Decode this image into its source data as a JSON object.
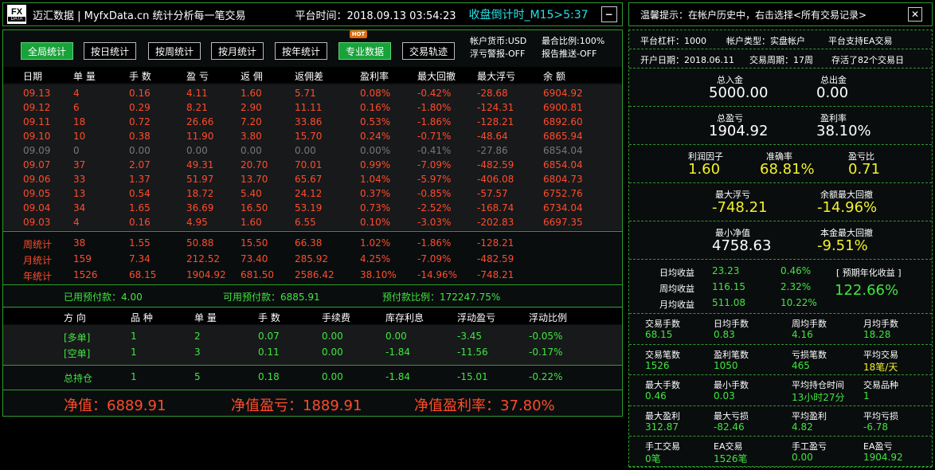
{
  "header": {
    "logo_top": "FX",
    "logo_bottom": "DATA",
    "brand": "迈汇数据 | MyfxData.cn  统计分析每一笔交易",
    "platform_time": "平台时间：2018.09.13 03:54:23",
    "countdown": "收盘倒计时_M15>5:37",
    "minimize": "−"
  },
  "tabs": [
    {
      "label": "全局统计",
      "active": true
    },
    {
      "label": "按日统计",
      "active": false
    },
    {
      "label": "按周统计",
      "active": false
    },
    {
      "label": "按月统计",
      "active": false
    },
    {
      "label": "按年统计",
      "active": false
    },
    {
      "label": "专业数据",
      "active": true
    },
    {
      "label": "交易轨迹",
      "active": false
    }
  ],
  "hot_badge": "HOT",
  "account_info": {
    "currency": "帐户货币:USD",
    "leverage_ratio": "最合比例:100%",
    "float_alert": "浮亏警报-OFF",
    "report_push": "报告推送-OFF"
  },
  "daily_table": {
    "columns": [
      "日期",
      "单 量",
      "手 数",
      "盈 亏",
      "返 佣",
      "返佣差",
      "盈利率",
      "最大回撤",
      "最大浮亏",
      "余 额"
    ],
    "rows": [
      [
        "09.13",
        "4",
        "0.16",
        "4.11",
        "1.60",
        "5.71",
        "0.08%",
        "-0.42%",
        "-28.68",
        "6904.92"
      ],
      [
        "09.12",
        "6",
        "0.29",
        "8.21",
        "2.90",
        "11.11",
        "0.16%",
        "-1.80%",
        "-124.31",
        "6900.81"
      ],
      [
        "09.11",
        "18",
        "0.72",
        "26.66",
        "7.20",
        "33.86",
        "0.53%",
        "-1.86%",
        "-128.21",
        "6892.60"
      ],
      [
        "09.10",
        "10",
        "0.38",
        "11.90",
        "3.80",
        "15.70",
        "0.24%",
        "-0.71%",
        "-48.64",
        "6865.94"
      ],
      [
        "09.09",
        "0",
        "0.00",
        "0.00",
        "0.00",
        "0.00",
        "0.00%",
        "-0.41%",
        "-27.86",
        "6854.04"
      ],
      [
        "09.07",
        "37",
        "2.07",
        "49.31",
        "20.70",
        "70.01",
        "0.99%",
        "-7.09%",
        "-482.59",
        "6854.04"
      ],
      [
        "09.06",
        "33",
        "1.37",
        "51.97",
        "13.70",
        "65.67",
        "1.04%",
        "-5.97%",
        "-406.08",
        "6804.73"
      ],
      [
        "09.05",
        "13",
        "0.54",
        "18.72",
        "5.40",
        "24.12",
        "0.37%",
        "-0.85%",
        "-57.57",
        "6752.76"
      ],
      [
        "09.04",
        "34",
        "1.65",
        "36.69",
        "16.50",
        "53.19",
        "0.73%",
        "-2.52%",
        "-168.74",
        "6734.04"
      ],
      [
        "09.03",
        "4",
        "0.16",
        "4.95",
        "1.60",
        "6.55",
        "0.10%",
        "-3.03%",
        "-202.83",
        "6697.35"
      ]
    ],
    "gray_row": 4
  },
  "period_stats": [
    [
      "周统计",
      "38",
      "1.55",
      "50.88",
      "15.50",
      "66.38",
      "1.02%",
      "-1.86%",
      "-128.21"
    ],
    [
      "月统计",
      "159",
      "7.34",
      "212.52",
      "73.40",
      "285.92",
      "4.25%",
      "-7.09%",
      "-482.59"
    ],
    [
      "年统计",
      "1526",
      "68.15",
      "1904.92",
      "681.50",
      "2586.42",
      "38.10%",
      "-14.96%",
      "-748.21"
    ]
  ],
  "prepay": {
    "used": "已用预付款：4.00",
    "available": "可用预付款：6885.91",
    "ratio": "预付款比例：172247.75%"
  },
  "positions": {
    "columns": [
      "方 向",
      "品 种",
      "单 量",
      "手 数",
      "手续费",
      "库存利息",
      "浮动盈亏",
      "浮动比例"
    ],
    "rows": [
      [
        "[多单]",
        "1",
        "2",
        "0.07",
        "0.00",
        "0.00",
        "-3.45",
        "-0.05%"
      ],
      [
        "[空单]",
        "1",
        "3",
        "0.11",
        "0.00",
        "-1.84",
        "-11.56",
        "-0.17%"
      ]
    ],
    "total": [
      "总持仓",
      "1",
      "5",
      "0.18",
      "0.00",
      "-1.84",
      "-15.01",
      "-0.22%"
    ]
  },
  "net": {
    "equity": "净值：6889.91",
    "equity_pnl": "净值盈亏：1889.91",
    "equity_rate": "净值盈利率：37.80%"
  },
  "right": {
    "tip": "温馨提示：在帐户历史中，右击选择<所有交易记录>",
    "close": "✕",
    "info_line1": [
      "平台杠杆：1000",
      "帐户类型：实盘帐户",
      "平台支持EA交易"
    ],
    "info_line2": [
      "开户日期：2018.06.11",
      "交易周期：17周",
      "存活了82个交易日"
    ],
    "deposit": {
      "label": "总入金",
      "value": "5000.00"
    },
    "withdraw": {
      "label": "总出金",
      "value": "0.00"
    },
    "total_pnl": {
      "label": "总盈亏",
      "value": "1904.92"
    },
    "profit_rate": {
      "label": "盈利率",
      "value": "38.10%"
    },
    "profit_factor": {
      "label": "利润因子",
      "value": "1.60"
    },
    "accuracy": {
      "label": "准确率",
      "value": "68.81%"
    },
    "pl_ratio": {
      "label": "盈亏比",
      "value": "0.71"
    },
    "max_float": {
      "label": "最大浮亏",
      "value": "-748.21"
    },
    "max_balance_dd": {
      "label": "余额最大回撤",
      "value": "-14.96%"
    },
    "min_equity": {
      "label": "最小净值",
      "value": "4758.63"
    },
    "max_principal_dd": {
      "label": "本金最大回撤",
      "value": "-9.51%"
    },
    "returns": [
      {
        "label": "日均收益",
        "value": "23.23",
        "pct": "0.46%"
      },
      {
        "label": "周均收益",
        "value": "116.15",
        "pct": "2.32%"
      },
      {
        "label": "月均收益",
        "value": "511.08",
        "pct": "10.22%"
      }
    ],
    "annual": {
      "label": "[ 预期年化收益 ]",
      "value": "122.66%"
    },
    "grid": [
      [
        {
          "label": "交易手数",
          "value": "68.15"
        },
        {
          "label": "日均手数",
          "value": "0.83"
        },
        {
          "label": "周均手数",
          "value": "4.16"
        },
        {
          "label": "月均手数",
          "value": "18.28"
        }
      ],
      [
        {
          "label": "交易笔数",
          "value": "1526"
        },
        {
          "label": "盈利笔数",
          "value": "1050"
        },
        {
          "label": "亏损笔数",
          "value": "465"
        },
        {
          "label": "平均交易",
          "value": "18笔/天",
          "yellow": true
        }
      ],
      [
        {
          "label": "最大手数",
          "value": "0.46"
        },
        {
          "label": "最小手数",
          "value": "0.03"
        },
        {
          "label": "平均持仓时间",
          "value": "13小时27分"
        },
        {
          "label": "交易品种",
          "value": "1"
        }
      ],
      [
        {
          "label": "最大盈利",
          "value": "312.87"
        },
        {
          "label": "最大亏损",
          "value": "-82.46"
        },
        {
          "label": "平均盈利",
          "value": "4.82"
        },
        {
          "label": "平均亏损",
          "value": "-6.78"
        }
      ],
      [
        {
          "label": "手工交易",
          "value": "0笔"
        },
        {
          "label": "EA交易",
          "value": "1526笔"
        },
        {
          "label": "手工盈亏",
          "value": "0.00"
        },
        {
          "label": "EA盈亏",
          "value": "1904.92"
        }
      ]
    ]
  }
}
